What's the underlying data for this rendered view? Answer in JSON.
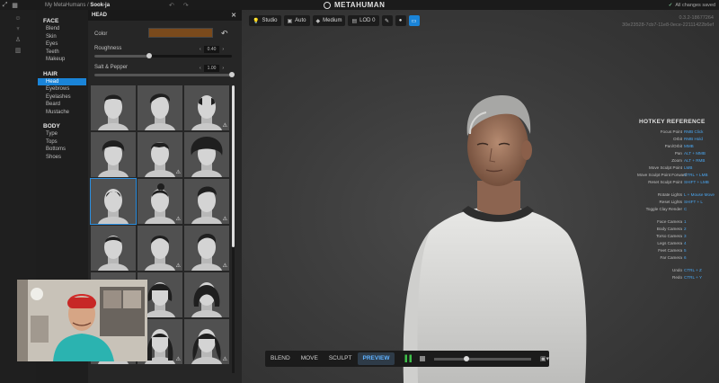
{
  "topbar": {
    "breadcrumb_parent": "My MetaHumans /",
    "breadcrumb_current": "Sook-ja",
    "undo_glyphs": "↶ ↷",
    "app_title": "METAHUMAN",
    "save_status": "All changes saved"
  },
  "nav": {
    "face": {
      "heading": "FACE",
      "items": [
        "Blend",
        "Skin",
        "Eyes",
        "Teeth",
        "Makeup"
      ]
    },
    "hair": {
      "heading": "HAIR",
      "items": [
        "Head",
        "Eyebrows",
        "Eyelashes",
        "Beard",
        "Mustache"
      ],
      "active": "Head"
    },
    "body": {
      "heading": "BODY",
      "items": [
        "Type",
        "Tops",
        "Bottoms",
        "Shoes"
      ]
    }
  },
  "panel": {
    "title": "HEAD",
    "color_label": "Color",
    "color_value": "#7a4a1c",
    "roughness_label": "Roughness",
    "roughness_value": "0.40",
    "roughness_fraction": 0.4,
    "salt_pepper_label": "Salt & Pepper",
    "salt_pepper_value": "1.00",
    "salt_pepper_fraction": 1.0,
    "tiles": [
      {
        "hair": "short-fade",
        "warn": false
      },
      {
        "hair": "swept",
        "warn": false
      },
      {
        "hair": "balding",
        "warn": true
      },
      {
        "hair": "curly-short",
        "warn": false
      },
      {
        "hair": "buzz-fringe",
        "warn": true
      },
      {
        "hair": "afro",
        "warn": false
      },
      {
        "hair": "mohawk-short",
        "warn": false,
        "selected": true
      },
      {
        "hair": "topknot",
        "warn": true
      },
      {
        "hair": "pomp",
        "warn": true
      },
      {
        "hair": "crew",
        "warn": false
      },
      {
        "hair": "side-part",
        "warn": true
      },
      {
        "hair": "quiff",
        "warn": true
      },
      {
        "hair": "bob-dark",
        "warn": false
      },
      {
        "hair": "bob-fringe",
        "warn": false
      },
      {
        "hair": "bob-long",
        "warn": false
      },
      {
        "hair": "long-straight",
        "warn": true
      },
      {
        "hair": "long-fringe",
        "warn": true
      },
      {
        "hair": "long-wavy",
        "warn": true
      }
    ]
  },
  "viewport": {
    "tools": {
      "lighting": "Studio",
      "camera": "Auto",
      "quality": "Medium",
      "lod": "LOD 0"
    },
    "version_line1": "0.3.2-18677264",
    "version_line2": "30e23528-7cb7-11e8-0ece-22111422b6ef"
  },
  "hotkeys": {
    "title": "HOTKEY REFERENCE",
    "groups": [
      [
        {
          "action": "Focus Point",
          "key": "RMB Click"
        },
        {
          "action": "Orbit",
          "key": "RMB Hold"
        },
        {
          "action": "Pan/Orbit",
          "key": "MMB"
        },
        {
          "action": "Pan",
          "key": "ALT + MMB"
        },
        {
          "action": "Zoom",
          "key": "ALT + RMB"
        },
        {
          "action": "Move Sculpt Point",
          "key": "LMB"
        },
        {
          "action": "Move Sculpt Point Forward",
          "key": "CTRL + LMB"
        },
        {
          "action": "Reset Sculpt Point",
          "key": "SHIFT + LMB"
        }
      ],
      [
        {
          "action": "Rotate Lights",
          "key": "L + Mouse Move"
        },
        {
          "action": "Reset Lights",
          "key": "SHIFT + L"
        },
        {
          "action": "Toggle Clay Render",
          "key": "C"
        }
      ],
      [
        {
          "action": "Face Camera",
          "key": "1"
        },
        {
          "action": "Body Camera",
          "key": "2"
        },
        {
          "action": "Torso Camera",
          "key": "3"
        },
        {
          "action": "Legs Camera",
          "key": "4"
        },
        {
          "action": "Feet Camera",
          "key": "5"
        },
        {
          "action": "Far Camera",
          "key": "6"
        }
      ],
      [
        {
          "action": "Undo",
          "key": "CTRL + Z"
        },
        {
          "action": "Redo",
          "key": "CTRL + Y"
        }
      ]
    ]
  },
  "modes": {
    "items": [
      "BLEND",
      "MOVE",
      "SCULPT",
      "PREVIEW"
    ],
    "active": "PREVIEW"
  },
  "timeline": {
    "progress": 0.3
  },
  "colors": {
    "accent": "#1a84d8",
    "hotkey": "#4aa6f0",
    "play": "#3fc24a"
  }
}
